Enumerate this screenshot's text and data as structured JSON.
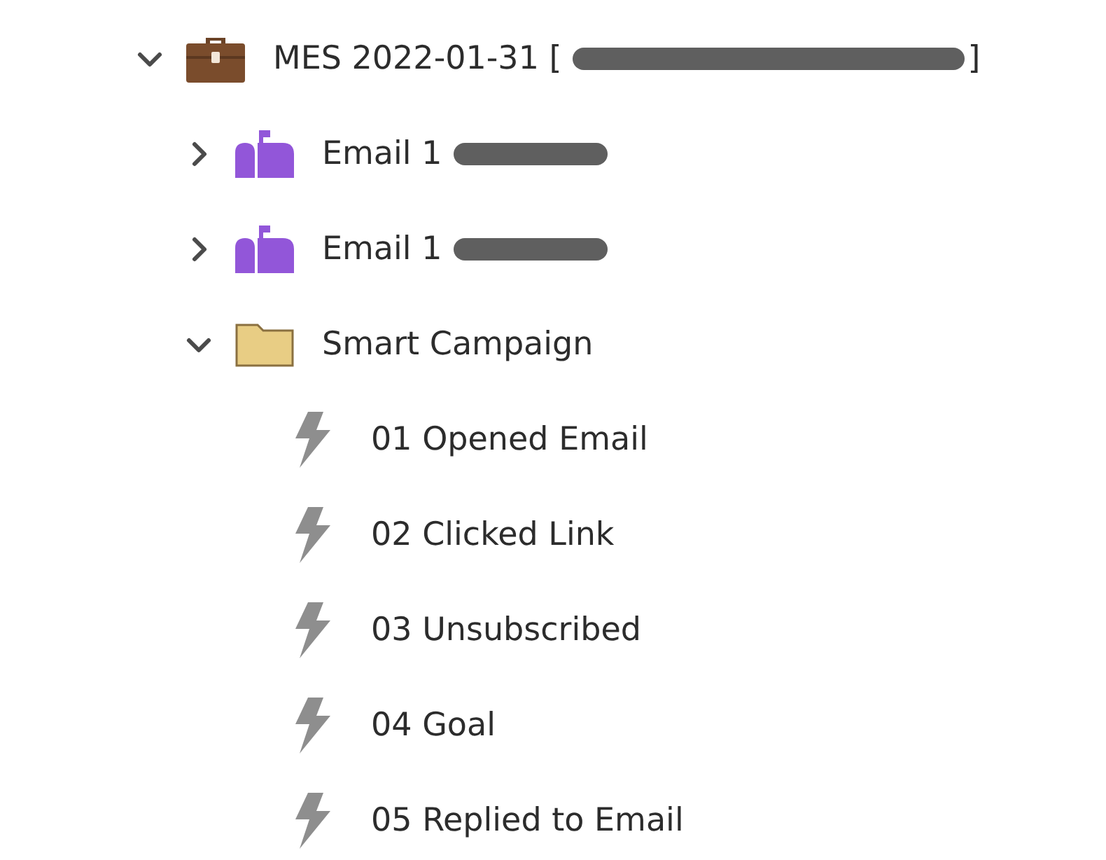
{
  "tree": [
    {
      "kind": "program",
      "label": "MES 2022-01-31 [",
      "redacted": true,
      "suffix": "]",
      "expanded": true,
      "children": [
        {
          "kind": "email",
          "label": "Email 1",
          "redacted": true,
          "expanded": false
        },
        {
          "kind": "email",
          "label": "Email 1",
          "redacted": true,
          "expanded": false
        },
        {
          "kind": "folder",
          "label": "Smart Campaign",
          "expanded": true,
          "children": [
            {
              "kind": "trigger",
              "label": "01 Opened Email"
            },
            {
              "kind": "trigger",
              "label": "02 Clicked Link"
            },
            {
              "kind": "trigger",
              "label": "03 Unsubscribed"
            },
            {
              "kind": "trigger",
              "label": "04 Goal"
            },
            {
              "kind": "trigger",
              "label": "05 Replied to Email"
            }
          ]
        }
      ]
    }
  ]
}
